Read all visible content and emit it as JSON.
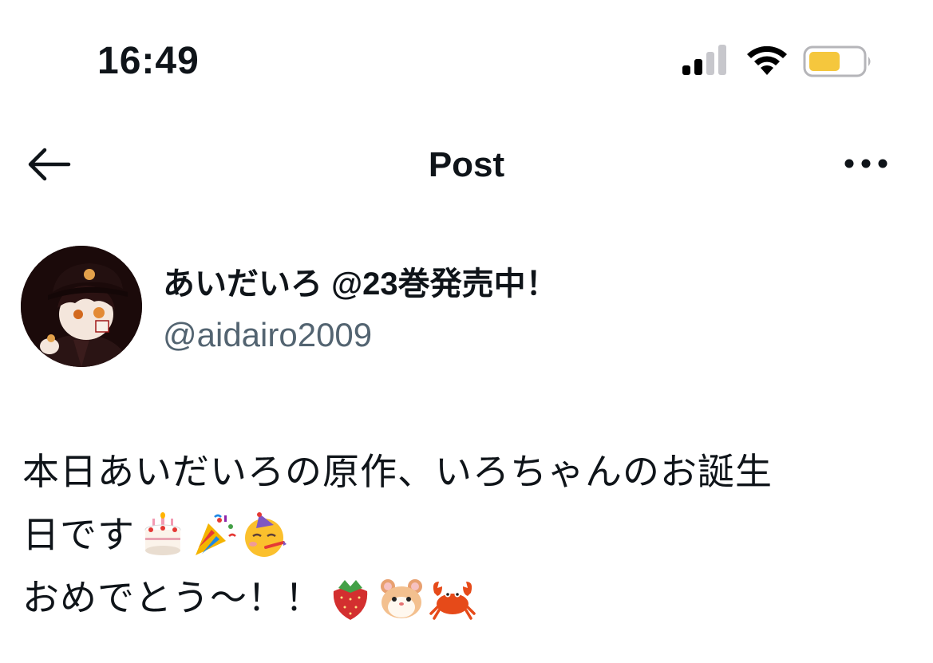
{
  "status_bar": {
    "time": "16:49",
    "battery_color": "#f5c73d"
  },
  "nav": {
    "title": "Post"
  },
  "author": {
    "name": "あいだいろ @23巻発売中！",
    "handle": "@aidairo2009"
  },
  "post": {
    "line1": "本日あいだいろの原作、いろちゃんのお誕生",
    "line2": "日です",
    "line3": "おめでとう〜！！",
    "line2_emojis": [
      "birthday-cake-icon",
      "party-popper-icon",
      "partying-face-icon"
    ],
    "line3_emojis": [
      "strawberry-icon",
      "hamster-icon",
      "crab-icon"
    ]
  },
  "colors": {
    "text": "#0f1419",
    "secondary_text": "#536471"
  }
}
